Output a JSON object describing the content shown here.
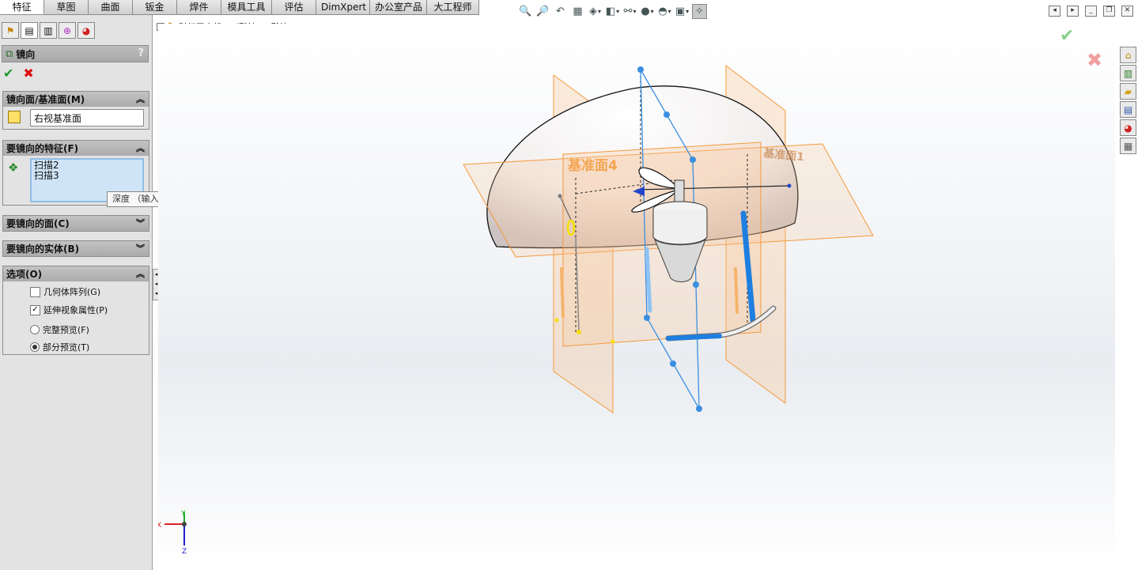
{
  "tabs": [
    "特征",
    "草图",
    "曲面",
    "钣金",
    "焊件",
    "模具工具",
    "评估",
    "DimXpert",
    "办公室产品",
    "大工程师"
  ],
  "active_tab": "特征",
  "hud_icons": [
    "zoom-fit-icon",
    "zoom-area-icon",
    "previous-view-icon",
    "section-view-icon",
    "view-orientation-icon",
    "display-style-icon",
    "hide-show-icon",
    "edit-appearance-icon",
    "apply-scene-icon",
    "view-settings-icon",
    "realview-icon"
  ],
  "tree": {
    "root_label": "科幻无人机2 （默认<<默认>_..."
  },
  "property_manager": {
    "title": "镜向",
    "help": "?",
    "groups": {
      "mirror_plane": {
        "header": "镜向面/基准面(M)",
        "value": "右视基准面"
      },
      "features": {
        "header": "要镜向的特征(F)",
        "items": [
          "扫描2",
          "扫描3"
        ]
      },
      "faces": {
        "header": "要镜向的面(C)"
      },
      "bodies": {
        "header": "要镜向的实体(B)"
      },
      "options": {
        "header": "选项(O)",
        "geometry_pattern": "几何体阵列(G)",
        "propagate_visual": "延伸视象属性(P)",
        "full_preview": "完整预览(F)",
        "partial_preview": "部分预览(T)"
      }
    }
  },
  "tooltip": "深度 （输入值或以 = 开始，以创建方程式）",
  "viewport_labels": {
    "plane4": "基准面4",
    "plane1": "基准面1"
  },
  "triad": {
    "x": "X",
    "y": "Y",
    "z": "Z"
  },
  "colors": {
    "plane": "#f39a3c",
    "sketch": "#3a8fe0",
    "ok": "#1d9a2a",
    "cancel": "#d11111"
  }
}
